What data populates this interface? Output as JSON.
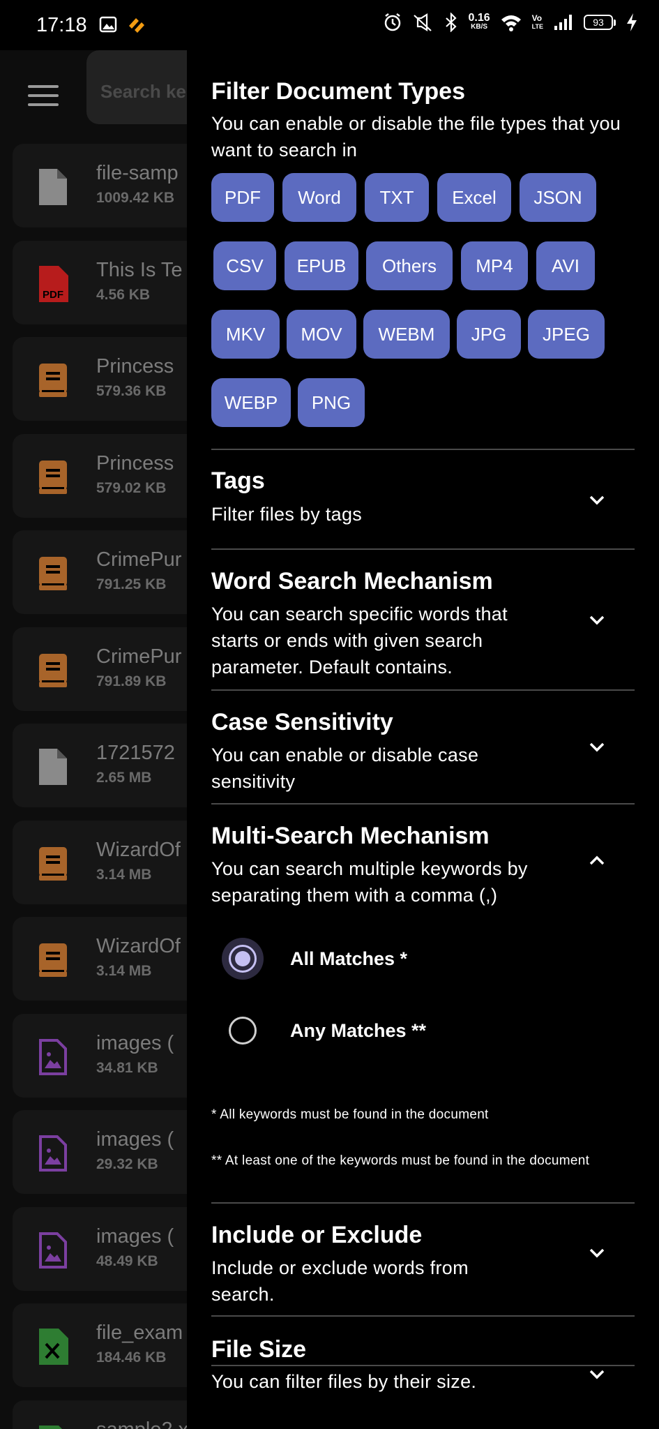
{
  "status_bar": {
    "time": "17:18",
    "net_speed_value": "0.16",
    "net_speed_unit": "KB/S",
    "volte_top": "Vo",
    "volte_bottom": "LTE",
    "battery": "93",
    "icons": [
      "gallery-icon",
      "app-notification-icon",
      "alarm-icon",
      "mute-icon",
      "bluetooth-icon",
      "wifi-icon",
      "signal-icon",
      "charging-icon"
    ]
  },
  "background": {
    "search_placeholder": "Search ke",
    "files": [
      {
        "name": "file-samp",
        "size": "1009.42 KB",
        "icon": "document-icon",
        "color": "#8a8a8a"
      },
      {
        "name": "This Is Te",
        "size": "4.56 KB",
        "icon": "pdf-icon",
        "color": "#b71c1c"
      },
      {
        "name": "Princess",
        "size": "579.36 KB",
        "icon": "book-icon",
        "color": "#a8642a"
      },
      {
        "name": "Princess",
        "size": "579.02 KB",
        "icon": "book-icon",
        "color": "#a8642a"
      },
      {
        "name": "CrimePur",
        "size": "791.25 KB",
        "icon": "book-icon",
        "color": "#a8642a"
      },
      {
        "name": "CrimePur",
        "size": "791.89 KB",
        "icon": "book-icon",
        "color": "#a8642a"
      },
      {
        "name": "1721572",
        "size": "2.65 MB",
        "icon": "document-icon",
        "color": "#8a8a8a"
      },
      {
        "name": "WizardOf",
        "size": "3.14 MB",
        "icon": "book-icon",
        "color": "#a8642a"
      },
      {
        "name": "WizardOf",
        "size": "3.14 MB",
        "icon": "book-icon",
        "color": "#a8642a"
      },
      {
        "name": "images (",
        "size": "34.81 KB",
        "icon": "image-icon",
        "color": "#7b3fa0"
      },
      {
        "name": "images (",
        "size": "29.32 KB",
        "icon": "image-icon",
        "color": "#7b3fa0"
      },
      {
        "name": "images (",
        "size": "48.49 KB",
        "icon": "image-icon",
        "color": "#7b3fa0"
      },
      {
        "name": "file_exam",
        "size": "184.46 KB",
        "icon": "spreadsheet-icon",
        "color": "#2e7d32"
      },
      {
        "name": "sample2.x",
        "size": "",
        "icon": "spreadsheet-icon",
        "color": "#2e7d32"
      }
    ]
  },
  "drawer": {
    "filter_types": {
      "title": "Filter Document Types",
      "subtitle": "You can enable or disable the file types that you want to search in",
      "chips": [
        "PDF",
        "Word",
        "TXT",
        "Excel",
        "JSON",
        "CSV",
        "EPUB",
        "Others",
        "MP4",
        "AVI",
        "MKV",
        "MOV",
        "WEBM",
        "JPG",
        "JPEG",
        "WEBP",
        "PNG"
      ]
    },
    "tags": {
      "title": "Tags",
      "subtitle": "Filter files by tags"
    },
    "word_search": {
      "title": "Word Search Mechanism",
      "line1": "You can search specific words that",
      "line2": "starts or ends with given search",
      "line3": "parameter. Default contains."
    },
    "case_sensitivity": {
      "title": "Case Sensitivity",
      "line1": "You can enable or disable case",
      "line2": "sensitivity"
    },
    "multi_search": {
      "title": "Multi-Search Mechanism",
      "line1": "You can search multiple keywords by",
      "line2": "separating them with a comma (,)",
      "options": [
        {
          "label": "All Matches *",
          "selected": true
        },
        {
          "label": "Any Matches **",
          "selected": false
        }
      ],
      "note1": "* All keywords must be found in the document",
      "note2": "** At least one of the keywords must be found in the document"
    },
    "include_exclude": {
      "title": "Include or Exclude",
      "line1": "Include or exclude words from",
      "line2": "search."
    },
    "file_size": {
      "title": "File Size",
      "subtitle": "You can filter files by their size."
    },
    "colors": {
      "chip": "#5c6bc0",
      "radio_selected": "#c5c0f2",
      "divider": "#4a4a4a"
    }
  }
}
